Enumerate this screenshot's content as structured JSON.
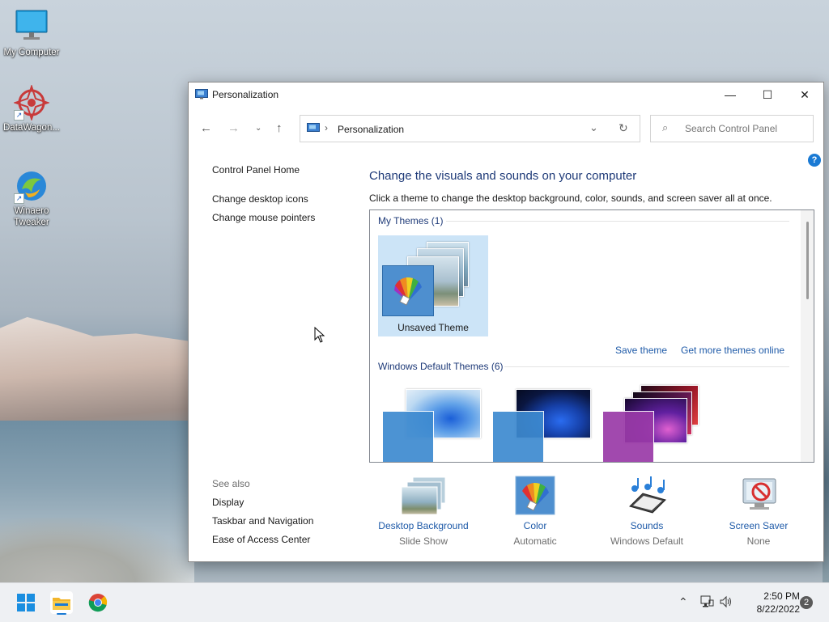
{
  "desktop": {
    "icons": [
      {
        "label": "My Computer"
      },
      {
        "label": "DataWagon..."
      },
      {
        "label": "Winaero Tweaker"
      }
    ]
  },
  "window": {
    "title": "Personalization",
    "controls": {
      "minimize": "—",
      "maximize": "☐",
      "close": "✕"
    },
    "address": {
      "crumb": "Personalization"
    },
    "search": {
      "placeholder": "Search Control Panel"
    },
    "help": "?",
    "sidebar": {
      "home": "Control Panel Home",
      "links": [
        "Change desktop icons",
        "Change mouse pointers"
      ],
      "see_also_title": "See also",
      "see_also": [
        "Display",
        "Taskbar and Navigation",
        "Ease of Access Center"
      ]
    },
    "heading": "Change the visuals and sounds on your computer",
    "subheading": "Click a theme to change the desktop background, color, sounds, and screen saver all at once.",
    "themes": {
      "my_themes_header": "My Themes (1)",
      "unsaved_theme": "Unsaved Theme",
      "save_theme": "Save theme",
      "get_more": "Get more themes online",
      "default_header": "Windows Default Themes (6)"
    },
    "bottom": [
      {
        "label": "Desktop Background",
        "sub": "Slide Show"
      },
      {
        "label": "Color",
        "sub": "Automatic"
      },
      {
        "label": "Sounds",
        "sub": "Windows Default"
      },
      {
        "label": "Screen Saver",
        "sub": "None"
      }
    ]
  },
  "taskbar": {
    "time": "2:50 PM",
    "date": "8/22/2022",
    "notifications": "2"
  },
  "colors": {
    "accent": "#1e5aa8",
    "heading": "#1e3a78",
    "selected_tile": "#cce4f7"
  }
}
